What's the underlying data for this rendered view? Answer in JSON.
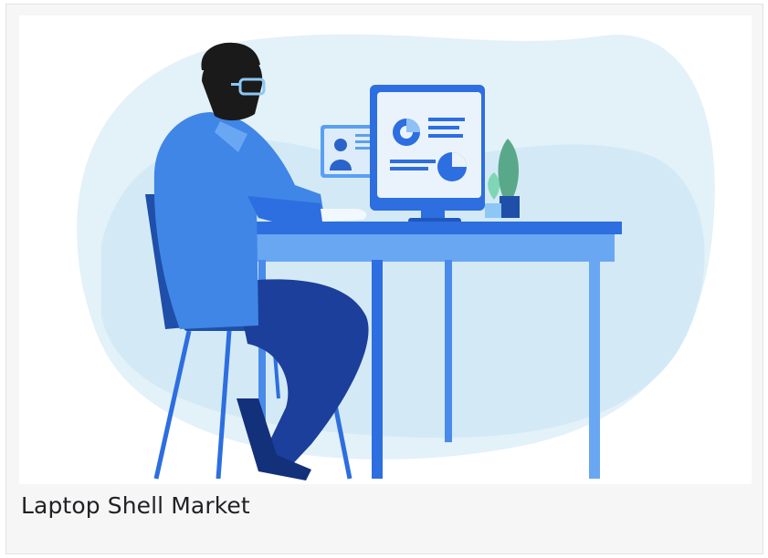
{
  "card": {
    "title": "Laptop Shell Market"
  }
}
